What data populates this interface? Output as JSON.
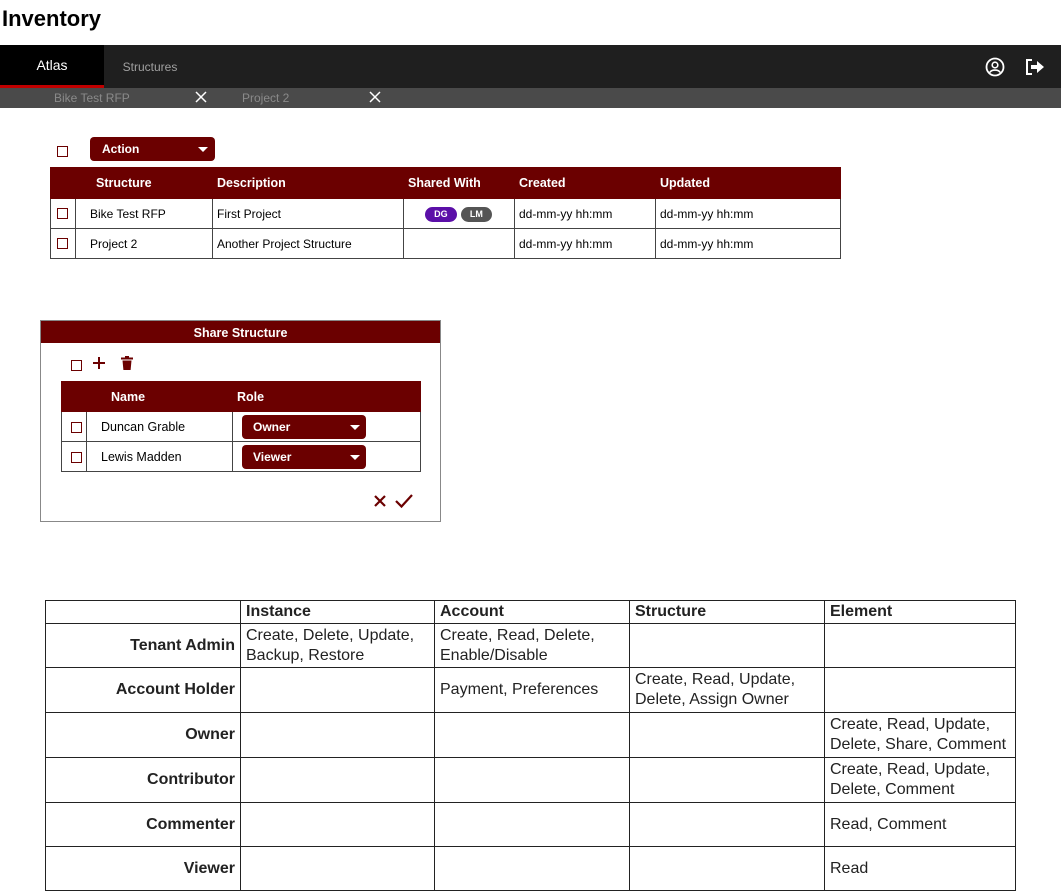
{
  "page": {
    "title": "Inventory"
  },
  "nav": {
    "tabs": [
      {
        "label": "Atlas"
      },
      {
        "label": "Structures"
      }
    ],
    "icons": {
      "account": "user-circle-icon",
      "logout": "sign-out-icon"
    }
  },
  "open_tabs": [
    {
      "label": "Bike Test RFP"
    },
    {
      "label": "Project 2"
    }
  ],
  "toolbar": {
    "action_label": "Action"
  },
  "structures": {
    "columns": [
      "Structure",
      "Description",
      "Shared With",
      "Created",
      "Updated"
    ],
    "rows": [
      {
        "structure": "Bike Test RFP",
        "description": "First Project",
        "shared_with": [
          "DG",
          "LM"
        ],
        "created": "dd-mm-yy hh:mm",
        "updated": "dd-mm-yy hh:mm"
      },
      {
        "structure": "Project 2",
        "description": "Another Project Structure",
        "shared_with": [],
        "created": "dd-mm-yy hh:mm",
        "updated": "dd-mm-yy hh:mm"
      }
    ],
    "badge_colors": {
      "DG": "#5b0fa8",
      "LM": "#555555"
    }
  },
  "share_dialog": {
    "title": "Share Structure",
    "columns": [
      "Name",
      "Role"
    ],
    "rows": [
      {
        "name": "Duncan Grable",
        "role": "Owner"
      },
      {
        "name": "Lewis Madden",
        "role": "Viewer"
      }
    ]
  },
  "permissions": {
    "columns": [
      "Instance",
      "Account",
      "Structure",
      "Element"
    ],
    "rows": [
      {
        "role": "Tenant Admin",
        "instance": [
          "Create, Delete, Update,",
          "Backup, Restore"
        ],
        "account": [
          "Create, Read, Delete,",
          "Enable/Disable"
        ],
        "structure": [],
        "element": []
      },
      {
        "role": "Account Holder",
        "instance": [],
        "account": [
          "Payment, Preferences"
        ],
        "structure": [
          "Create, Read, Update,",
          "Delete, Assign Owner"
        ],
        "element": []
      },
      {
        "role": "Owner",
        "instance": [],
        "account": [],
        "structure": [],
        "element": [
          "Create, Read, Update,",
          "Delete, Share, Comment"
        ]
      },
      {
        "role": "Contributor",
        "instance": [],
        "account": [],
        "structure": [],
        "element": [
          "Create, Read, Update,",
          "Delete, Comment"
        ]
      },
      {
        "role": "Commenter",
        "instance": [],
        "account": [],
        "structure": [],
        "element": [
          "Read, Comment"
        ]
      },
      {
        "role": "Viewer",
        "instance": [],
        "account": [],
        "structure": [],
        "element": [
          "Read"
        ]
      }
    ]
  },
  "colors": {
    "brand": "#6b0000",
    "nav_bg": "#1f1f1f",
    "accent_underline": "#c00000"
  }
}
